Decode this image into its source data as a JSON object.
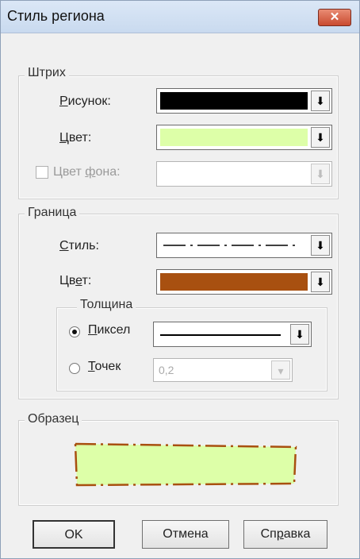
{
  "window": {
    "title": "Стиль региона"
  },
  "stroke": {
    "group_label": "Штрих",
    "pattern_label_u": "Р",
    "pattern_label_rest": "исунок:",
    "color_label_u": "Ц",
    "color_label_rest": "вет:",
    "bg_label_pre": "Цвет ",
    "bg_label_u": "ф",
    "bg_label_rest": "она:",
    "pattern_color": "#000000",
    "color_value": "#ddffa8",
    "bg_value": "#ffffff",
    "bg_checked": false,
    "bg_enabled": false
  },
  "border": {
    "group_label": "Граница",
    "style_label_u": "С",
    "style_label_rest": "тиль:",
    "color_label_pre": "Цв",
    "color_label_u": "е",
    "color_label_rest": "т:",
    "color_value": "#a85010",
    "thickness": {
      "group_label": "Толщина",
      "pixel_label_u": "П",
      "pixel_label_rest": "иксел",
      "points_label_u": "Т",
      "points_label_rest": "очек",
      "pixel_selected": true,
      "points_value": "0,2"
    }
  },
  "sample": {
    "group_label": "Образец",
    "fill": "#ddffa8",
    "stroke": "#a85010"
  },
  "buttons": {
    "ok": "OK",
    "cancel": "Отмена",
    "help_pre": "Сп",
    "help_u": "р",
    "help_rest": "авка"
  },
  "icons": {
    "close": "close-icon",
    "dropdown": "dropdown-arrow-icon"
  }
}
